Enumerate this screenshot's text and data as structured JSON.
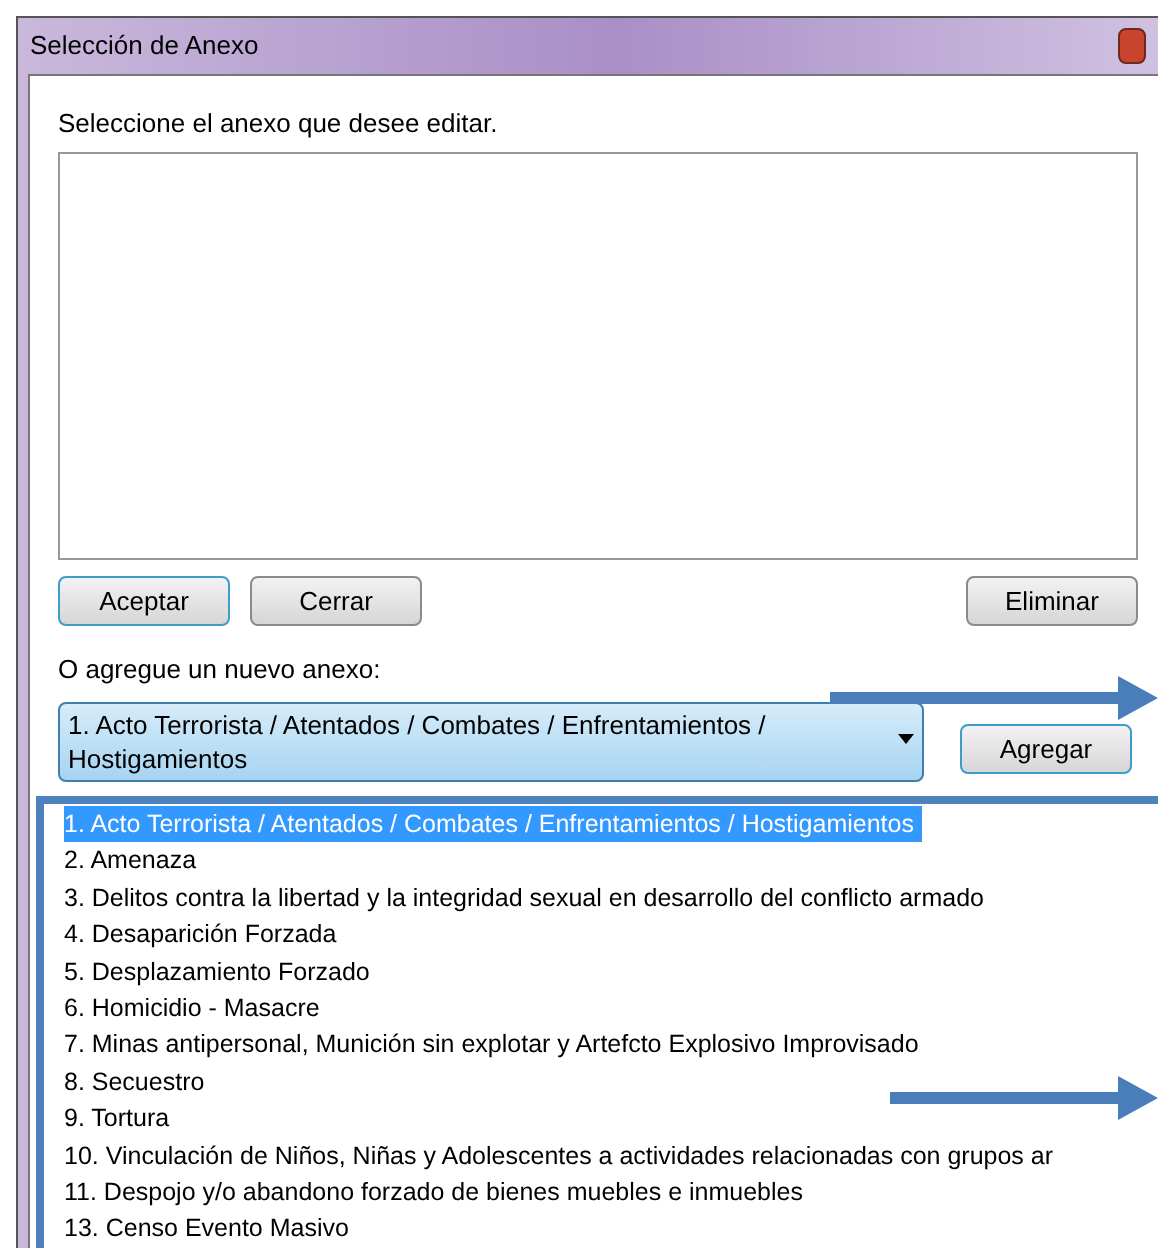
{
  "window": {
    "title": "Selección de Anexo"
  },
  "prompt": "Seleccione el anexo que desee editar.",
  "buttons": [
    {
      "label": "Aceptar",
      "focused": true
    },
    {
      "label": "Cerrar",
      "focused": false
    },
    {
      "label": "Eliminar",
      "focused": false
    }
  ],
  "new_label": "O agregue un nuevo anexo:",
  "combo": {
    "value": "1. Acto Terrorista / Atentados / Combates / Enfrentamientos / Hostigamientos"
  },
  "add_button": "Agregar",
  "options": [
    {
      "label": "1. Acto Terrorista / Atentados / Combates / Enfrentamientos / Hostigamientos",
      "selected": true
    },
    {
      "label": "2. Amenaza",
      "selected": false
    },
    {
      "label": "3. Delitos contra la libertad y la integridad sexual en desarrollo del conflicto armado",
      "selected": false
    },
    {
      "label": "4. Desaparición Forzada",
      "selected": false
    },
    {
      "label": "5. Desplazamiento Forzado",
      "selected": false
    },
    {
      "label": "6. Homicidio - Masacre",
      "selected": false
    },
    {
      "label": "7. Minas antipersonal, Munición sin explotar y Artefcto Explosivo Improvisado",
      "selected": false
    },
    {
      "label": "8. Secuestro",
      "selected": false
    },
    {
      "label": "9. Tortura",
      "selected": false
    },
    {
      "label": "10. Vinculación de Niños, Niñas y Adolescentes a actividades relacionadas con grupos ar",
      "selected": false
    },
    {
      "label": "11. Despojo y/o abandono forzado de bienes muebles e inmuebles",
      "selected": false
    },
    {
      "label": "13. Censo Evento Masivo",
      "selected": false
    }
  ]
}
